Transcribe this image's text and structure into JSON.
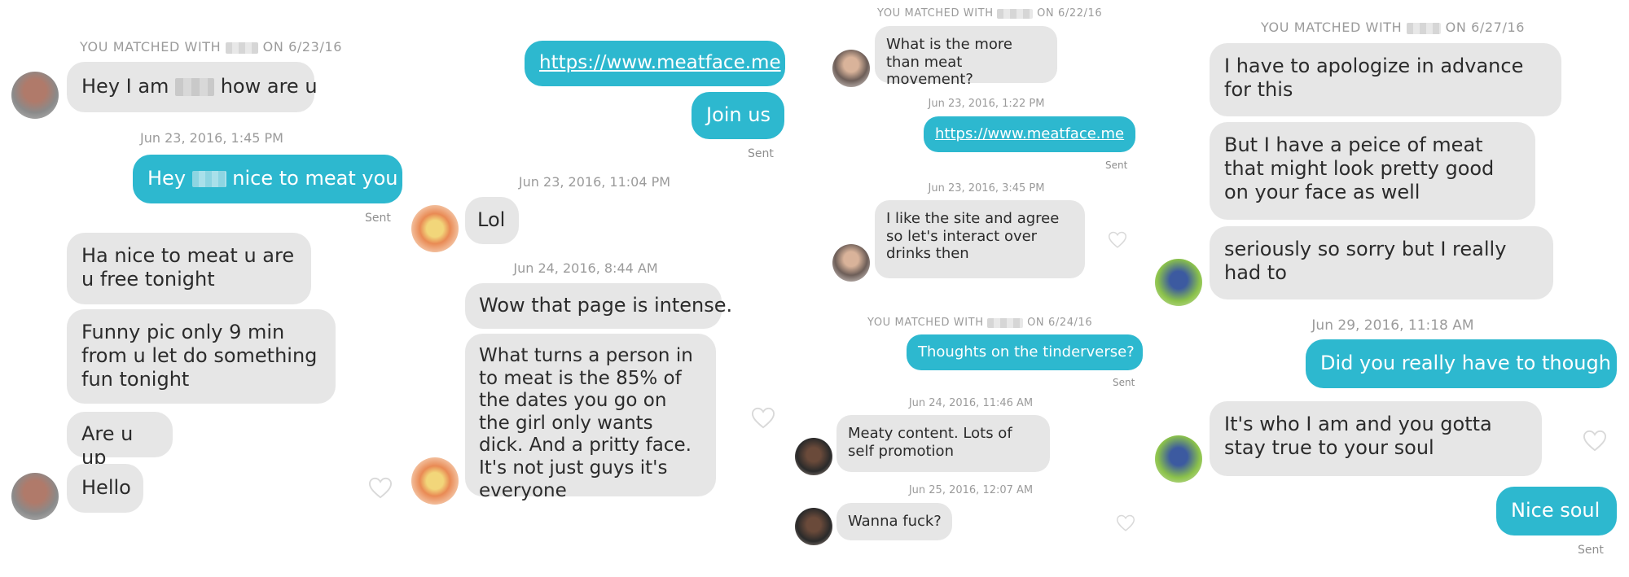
{
  "panel1": {
    "match_prefix": "YOU MATCHED WITH",
    "match_suffix": "ON 6/23/16",
    "msg1_a": "Hey I am",
    "msg1_b": "how are u",
    "ts1": "Jun 23, 2016, 1:45 PM",
    "sent_a": "Hey",
    "sent_b": "nice to meat you",
    "sent_label": "Sent",
    "msg2": "Ha nice to meat u are u free tonight",
    "msg3": "Funny pic only 9 min from u let do something fun tonight",
    "msg4": "Are u up",
    "msg5": "Hello"
  },
  "panel2": {
    "link": "https://www.meatface.me",
    "join": "Join us",
    "sent_label": "Sent",
    "ts1": "Jun 23, 2016, 11:04 PM",
    "msg1": "Lol",
    "ts2": "Jun 24, 2016, 8:44 AM",
    "msg2": "Wow that page is intense.",
    "msg3": "What turns a person in to meat is the 85% of the dates you go on the girl only wants dick. And a pritty face. It's not just guys it's everyone"
  },
  "panel3": {
    "match1_prefix": "YOU MATCHED WITH",
    "match1_suffix": "ON 6/22/16",
    "msg1": "What is the more than meat movement?",
    "ts1": "Jun 23, 2016, 1:22 PM",
    "link": "https://www.meatface.me",
    "sent_label": "Sent",
    "ts2": "Jun 23, 2016, 3:45 PM",
    "msg2": "I like the site and agree so let's interact over drinks then",
    "match2_prefix": "YOU MATCHED WITH",
    "match2_suffix": "ON 6/24/16",
    "out2": "Thoughts on the tinderverse?",
    "sent_label2": "Sent",
    "ts3": "Jun 24, 2016, 11:46 AM",
    "msg3": "Meaty content. Lots of self promotion",
    "ts4": "Jun 25, 2016, 12:07 AM",
    "msg4": "Wanna fuck?"
  },
  "panel4": {
    "match_prefix": "YOU MATCHED WITH",
    "match_suffix": "ON 6/27/16",
    "msg1": "I have to apologize in advance for this",
    "msg2": "But I have a peice of meat that might look pretty good on your face as well",
    "msg3": "seriously so sorry but I really had to",
    "ts1": "Jun 29, 2016, 11:18 AM",
    "out1": "Did you really have to though",
    "msg4": "It's who I am and you gotta stay true to your soul",
    "out2": "Nice soul",
    "sent_label": "Sent"
  },
  "colors": {
    "outgoing": "#2db8cf",
    "incoming": "#e6e6e6",
    "meta": "#9b9b9b"
  }
}
